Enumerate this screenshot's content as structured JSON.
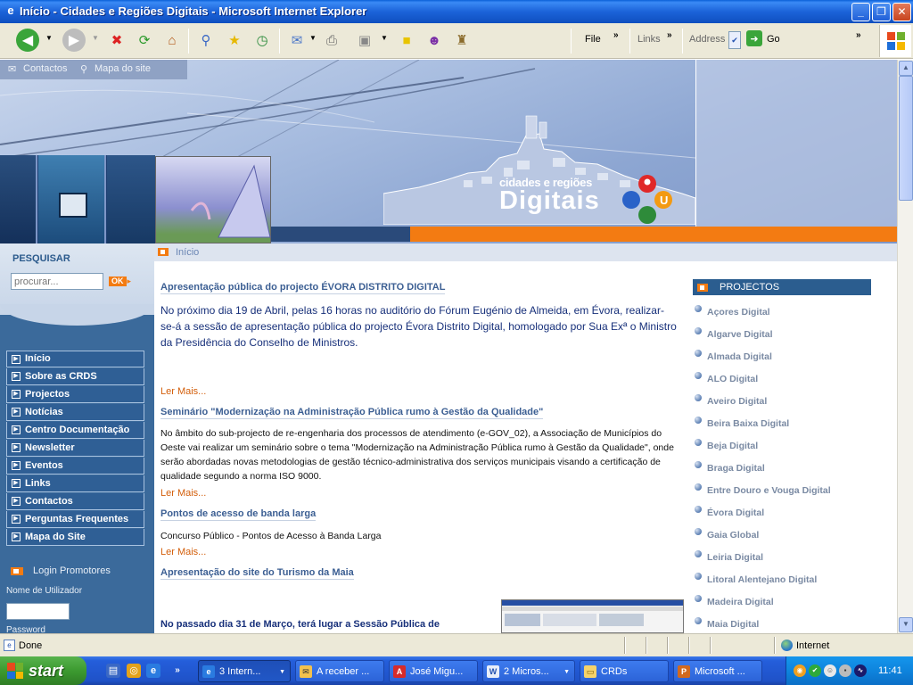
{
  "window": {
    "title": "Início - Cidades e Regiões Digitais - Microsoft Internet Explorer",
    "minimize_glyph": "_",
    "maximize_glyph": "❐",
    "close_glyph": "✕"
  },
  "toolbar": {
    "menu_file": "File",
    "links": "Links",
    "address": "Address",
    "go": "Go",
    "chevron": "»"
  },
  "site": {
    "top_links": [
      "Contactos",
      "Mapa do site"
    ],
    "logo_small": "cidades e regiões",
    "logo_big": "Digitais",
    "search": {
      "label": "PESQUISAR",
      "placeholder": "procurar...",
      "button": "OK"
    },
    "nav": [
      "Início",
      "Sobre as CRDS",
      "Projectos",
      "Notícias",
      "Centro Documentação",
      "Newsletter",
      "Eventos",
      "Links",
      "Contactos",
      "Perguntas Frequentes",
      "Mapa do Site"
    ],
    "login": {
      "title": "Login Promotores",
      "user_label": "Nome de Utilizador",
      "pass_label": "Password"
    },
    "breadcrumb": "Início",
    "news": [
      {
        "headline": "Apresentação pública do projecto ÉVORA DISTRITO DIGITAL",
        "body": "No próximo dia 19 de Abril, pelas 16 horas no auditório do Fórum Eugénio de Almeida, em Évora, realizar-se-á a sessão de apresentação pública do projecto Évora Distrito Digital, homologado por Sua Exª o Ministro da Presidência do Conselho de Ministros.",
        "more": "Ler Mais..."
      },
      {
        "headline": "Seminário \"Modernização na Administração Pública rumo à Gestão da Qualidade\"",
        "body": "No âmbito do sub-projecto de re-engenharia dos processos de atendimento (e-GOV_02), a Associação de Municípios do Oeste vai realizar um seminário sobre o tema \"Modernização na Administração Pública rumo à Gestão da Qualidade\", onde serão abordadas novas metodologias de gestão técnico-administrativa dos serviços municipais visando a certificação de qualidade segundo a norma ISO 9000.",
        "more": "Ler Mais..."
      },
      {
        "headline": "Pontos de acesso de banda larga",
        "body": "Concurso Público - Pontos de Acesso à Banda Larga",
        "more": "Ler Mais..."
      },
      {
        "headline": "Apresentação do site do Turismo da Maia",
        "body": "No passado dia 31 de Março, terá lugar a Sessão Pública de"
      }
    ],
    "projects": {
      "title": "PROJECTOS",
      "items": [
        "Açores Digital",
        "Algarve Digital",
        "Almada Digital",
        "ALO Digital",
        "Aveiro Digital",
        "Beira Baixa Digital",
        "Beja Digital",
        "Braga Digital",
        "Entre Douro e Vouga Digital",
        "Évora Digital",
        "Gaia Global",
        "Leiria Digital",
        "Litoral Alentejano Digital",
        "Madeira Digital",
        "Maia Digital"
      ]
    }
  },
  "status": {
    "text": "Done",
    "zone": "Internet"
  },
  "taskbar": {
    "start": "start",
    "tasks": [
      "3 Intern...",
      "A receber ...",
      "José Migu...",
      "2 Micros...",
      "CRDs",
      "Microsoft ..."
    ],
    "clock": "11:41"
  },
  "colors": {
    "accent_orange": "#f37b12",
    "nav_blue": "#2f5f95",
    "headline_blue": "#3c5f93",
    "xp_blue": "#245edb"
  }
}
